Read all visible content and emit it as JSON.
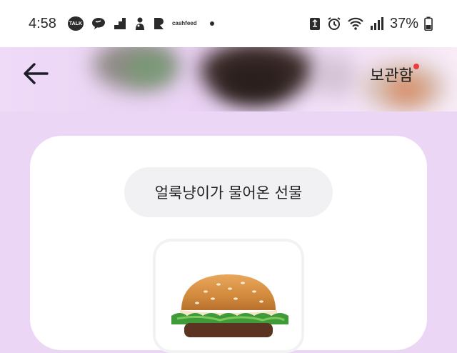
{
  "status_bar": {
    "time": "4:58",
    "notification_icons": [
      "kakaotalk-icon",
      "chat-bubble-icon",
      "stairs-icon",
      "mascot-icon",
      "b-app-icon",
      "cashfeed-icon"
    ],
    "talk_badge": "TALK",
    "cashfeed_label_top": "cash",
    "cashfeed_label_bottom": "feed",
    "system_icons": [
      "recycle-icon",
      "alarm-icon",
      "wifi-icon",
      "signal-icon",
      "battery-icon"
    ],
    "battery": "37%"
  },
  "header": {
    "back_icon": "arrow-left-icon",
    "storage_label": "보관함",
    "has_new_badge": true,
    "badge_color": "#ef3b3b"
  },
  "card": {
    "gift_title": "얼룩냥이가 물어온 선물",
    "item_image": "burger-image"
  },
  "colors": {
    "background": "#ecd6f6",
    "card": "#ffffff",
    "chip": "#f1f1f3"
  }
}
